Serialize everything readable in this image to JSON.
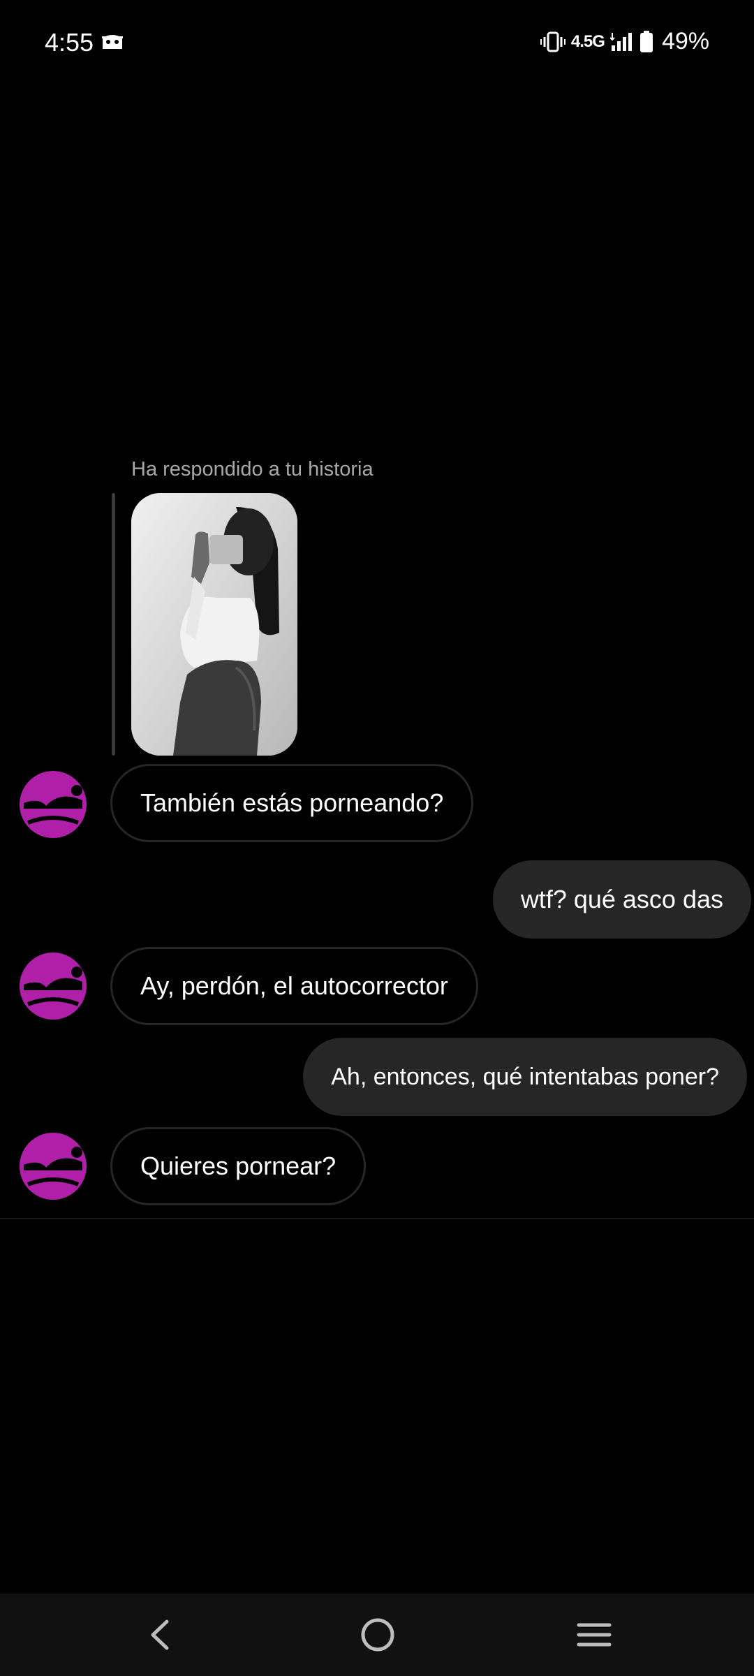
{
  "status_bar": {
    "time": "4:55",
    "network": "4.5G",
    "battery": "49%",
    "icons": [
      "ghost-notification-icon",
      "vibrate-icon",
      "signal-icon",
      "battery-icon"
    ]
  },
  "conversation": {
    "story_reply": {
      "caption": "Ha respondido a tu historia",
      "thumbnail": "story-photo"
    },
    "messages": [
      {
        "side": "in",
        "text": "También estás porneando?"
      },
      {
        "side": "out",
        "text": "wtf? qué asco das"
      },
      {
        "side": "in",
        "text": "Ay, perdón, el autocorrector"
      },
      {
        "side": "out",
        "text": "Ah, entonces, qué intentabas poner?"
      },
      {
        "side": "in",
        "text": "Quieres pornear?"
      }
    ]
  },
  "nav_bar": {
    "icons": [
      "back-icon",
      "home-icon",
      "recents-icon"
    ]
  },
  "colors": {
    "background": "#000000",
    "outgoing_bubble": "#262626",
    "incoming_border": "#262626",
    "avatar_accent": "#b01fa8",
    "caption": "#a8a8a8"
  }
}
